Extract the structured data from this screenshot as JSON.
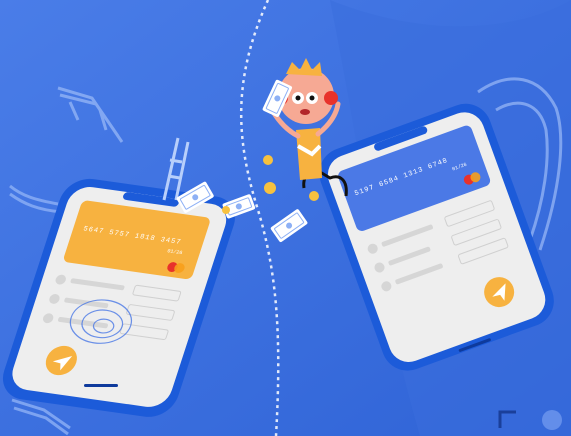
{
  "illustration": {
    "palette": {
      "background": "#3f74e3",
      "phone_frame": "#1d5bd8",
      "screen": "#efefef",
      "card_left": "#f7b240",
      "card_right": "#4b79e6",
      "send_button": "#f7b240",
      "mastercard_red": "#e8322b",
      "mastercard_orange": "#f79e1b"
    },
    "left_phone": {
      "card": {
        "number": "5647 5757 1818 3457",
        "expiry": "01/26"
      },
      "send_icon": "paper-plane-icon"
    },
    "right_phone": {
      "card": {
        "number": "5197 6584 1313 6748",
        "expiry": "01/26"
      },
      "send_icon": "paper-plane-icon"
    },
    "character": {
      "description": "cartoon-boy-with-headphones"
    },
    "icons": [
      "mastercard-logo-icon",
      "paper-plane-icon",
      "banknote-icon",
      "coin-icon",
      "sun-lounger-icon"
    ]
  }
}
